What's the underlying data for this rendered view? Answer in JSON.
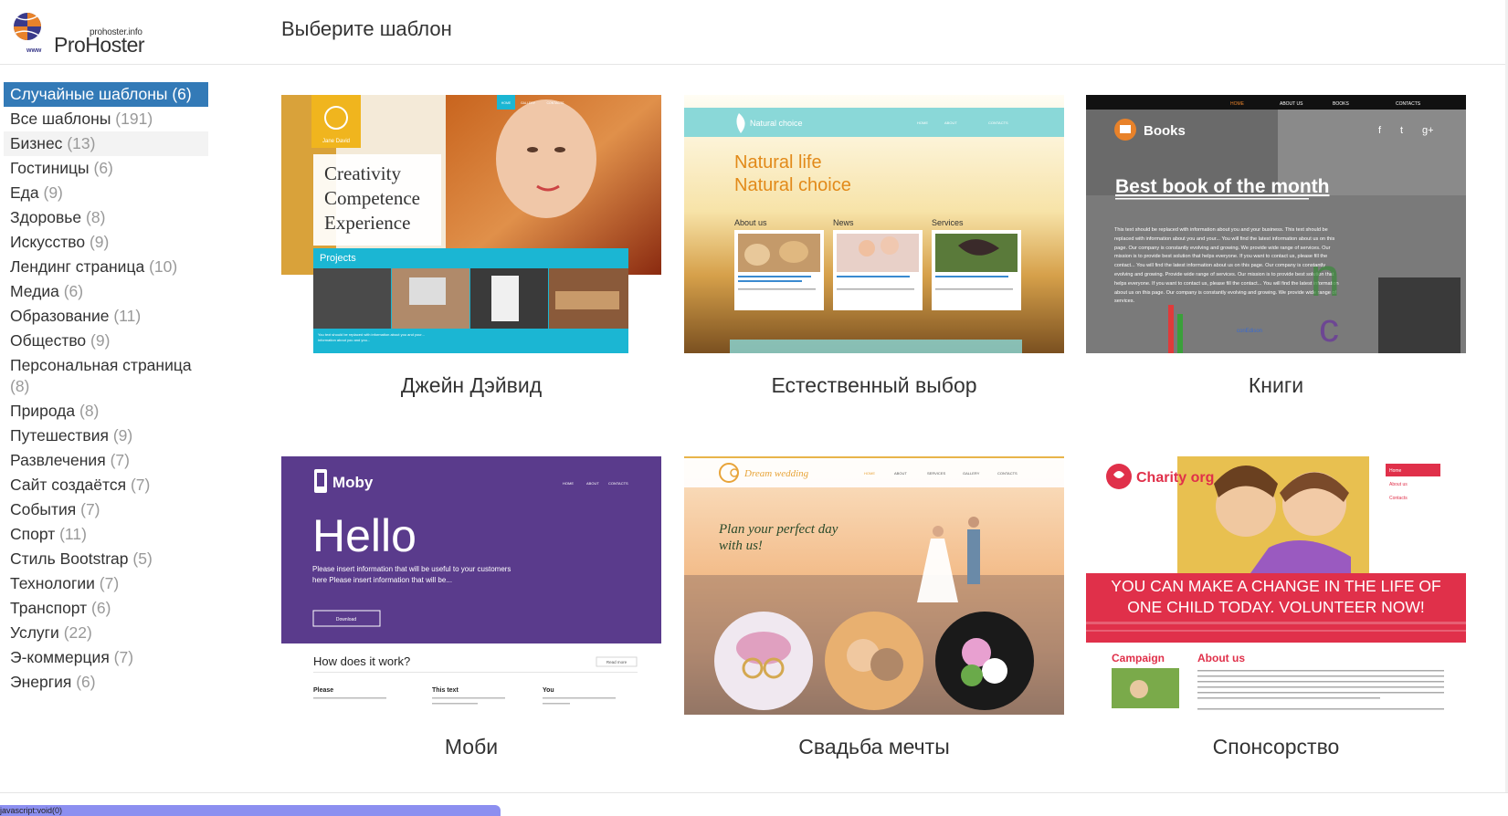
{
  "header": {
    "logo_small": "prohoster.info",
    "logo_main": "ProHoster",
    "logo_www": "www",
    "page_title": "Выберите шаблон"
  },
  "sidebar": {
    "items": [
      {
        "label": "Случайные шаблоны",
        "count": "(6)"
      },
      {
        "label": "Все шаблоны",
        "count": "(191)"
      },
      {
        "label": "Бизнес",
        "count": "(13)"
      },
      {
        "label": "Гостиницы",
        "count": "(6)"
      },
      {
        "label": "Еда",
        "count": "(9)"
      },
      {
        "label": "Здоровье",
        "count": "(8)"
      },
      {
        "label": "Искусство",
        "count": "(9)"
      },
      {
        "label": "Лендинг страница",
        "count": "(10)"
      },
      {
        "label": "Медиа",
        "count": "(6)"
      },
      {
        "label": "Образование",
        "count": "(11)"
      },
      {
        "label": "Общество",
        "count": "(9)"
      },
      {
        "label": "Персональная страница",
        "count": "(8)"
      },
      {
        "label": "Природа",
        "count": "(8)"
      },
      {
        "label": "Путешествия",
        "count": "(9)"
      },
      {
        "label": "Развлечения",
        "count": "(7)"
      },
      {
        "label": "Сайт создаётся",
        "count": "(7)"
      },
      {
        "label": "События",
        "count": "(7)"
      },
      {
        "label": "Спорт",
        "count": "(11)"
      },
      {
        "label": "Стиль Bootstrap",
        "count": "(5)"
      },
      {
        "label": "Технологии",
        "count": "(7)"
      },
      {
        "label": "Транспорт",
        "count": "(6)"
      },
      {
        "label": "Услуги",
        "count": "(22)"
      },
      {
        "label": "Э-коммерция",
        "count": "(7)"
      },
      {
        "label": "Энергия",
        "count": "(6)"
      }
    ]
  },
  "templates": [
    {
      "title": "Джейн Дэйвид",
      "thumb": {
        "nav": [
          "HOME",
          "GALLERY",
          "CONTACTS"
        ],
        "brand": "Jane David",
        "headline": [
          "Creativity",
          "Competence",
          "Experience"
        ],
        "section": "Projects",
        "footer_text": "You text should be replaced with information about you and your..."
      }
    },
    {
      "title": "Естественный выбор",
      "thumb": {
        "brand": "Natural choice",
        "nav": [
          "HOME",
          "ABOUT",
          "CONTACTS"
        ],
        "headline": [
          "Natural life",
          "Natural choice"
        ],
        "columns": [
          "About us",
          "News",
          "Services"
        ]
      }
    },
    {
      "title": "Книги",
      "thumb": {
        "nav": [
          "HOME",
          "ABOUT US",
          "BOOKS",
          "CONTACTS"
        ],
        "brand": "Books",
        "headline": "Best book of the month",
        "body": "This text should be replaced with information about you and your business. This text should be replaced with information about you and your... You will find the latest information about us on this page. Our company is constantly evolving and growing. We provide wide range of services. Our mission is to provide best solution that helps everyone. If you want to contact us, please fill the contact... You will find the latest information about us on this page. Our company is constantly evolving and growing. Provide wide range of services. Our mission is to provide best solution that helps everyone. If you want to contact us, please fill the contact... You will find the latest information about us on this page. Our company is constantly evolving and growing. We provide wide range of services.",
        "logo_text": "conEdison"
      }
    },
    {
      "title": "Моби",
      "thumb": {
        "brand": "Moby",
        "nav": [
          "HOME",
          "ABOUT",
          "CONTACTS"
        ],
        "headline": "Hello",
        "body": "Please insert information that will be useful to your customers here Please insert information that will be...",
        "button": "Download",
        "question": "How does it work?",
        "read_more": "Read more",
        "columns": [
          "Please",
          "This text",
          "You"
        ]
      }
    },
    {
      "title": "Свадьба мечты",
      "thumb": {
        "brand": "Dream wedding",
        "nav": [
          "HOME",
          "ABOUT",
          "SERVICES",
          "GALLERY",
          "CONTACTS"
        ],
        "headline": [
          "Plan your perfect day",
          "with us!"
        ]
      }
    },
    {
      "title": "Спонсорство",
      "thumb": {
        "brand": "Charity org",
        "nav": [
          "Home",
          "About us",
          "Contacts"
        ],
        "banner": [
          "YOU CAN MAKE A CHANGE IN THE LIFE OF",
          "ONE CHILD TODAY. VOLUNTEER NOW!"
        ],
        "columns": [
          "Campaign",
          "About us"
        ]
      }
    }
  ],
  "status_bar": {
    "text": "javascript:void(0)"
  },
  "colors": {
    "accent": "#337ab7",
    "count_gray": "#999999",
    "projects_cyan": "#1bb6d3",
    "natural_teal": "#8ad8d8",
    "moby_purple": "#5a3b8c",
    "charity_red": "#e0304a"
  }
}
